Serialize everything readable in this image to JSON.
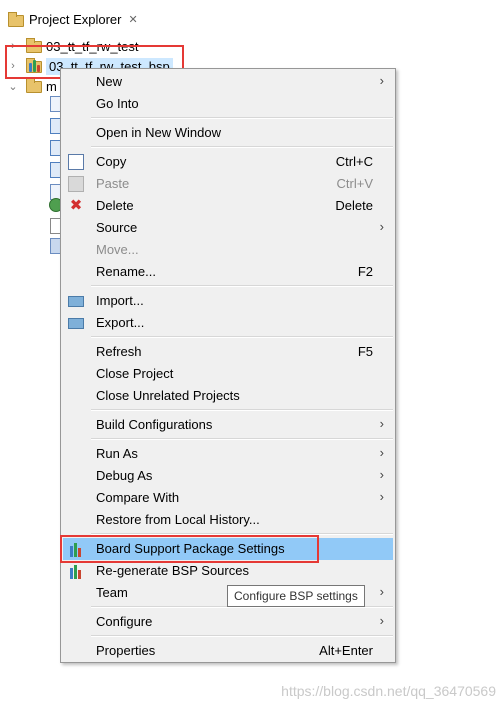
{
  "explorer": {
    "title": "Project Explorer",
    "close_glyph": "✕",
    "items": [
      {
        "label": "03_tt_tf_rw_test",
        "expanded": false
      },
      {
        "label": "03_tt_tf_rw_test_bsp",
        "expanded": false,
        "selected": true
      },
      {
        "label": "m",
        "expanded": true
      }
    ]
  },
  "menu": {
    "items": [
      {
        "label": "New",
        "mnemonic": "N",
        "shortcut": "",
        "submenu": true
      },
      {
        "label": "Go Into",
        "mnemonic": "I",
        "shortcut": ""
      },
      {
        "label": "Open in New Window",
        "mnemonic": "N",
        "shortcut": ""
      },
      {
        "label": "Copy",
        "mnemonic": "C",
        "shortcut": "Ctrl+C",
        "icon": "copy-icon"
      },
      {
        "label": "Paste",
        "mnemonic": "P",
        "shortcut": "Ctrl+V",
        "disabled": true,
        "icon": "paste-icon"
      },
      {
        "label": "Delete",
        "mnemonic": "D",
        "shortcut": "Delete",
        "icon": "delete-icon"
      },
      {
        "label": "Source",
        "mnemonic": "S",
        "shortcut": "",
        "submenu": true
      },
      {
        "label": "Move...",
        "mnemonic": "v",
        "shortcut": "",
        "disabled": true
      },
      {
        "label": "Rename...",
        "mnemonic": "m",
        "shortcut": "F2"
      },
      {
        "label": "Import...",
        "mnemonic": "I",
        "shortcut": "",
        "icon": "import-icon"
      },
      {
        "label": "Export...",
        "mnemonic": "o",
        "shortcut": "",
        "icon": "export-icon"
      },
      {
        "label": "Refresh",
        "mnemonic": "f",
        "shortcut": "F5"
      },
      {
        "label": "Close Project",
        "mnemonic": "",
        "shortcut": ""
      },
      {
        "label": "Close Unrelated Projects",
        "mnemonic": "U",
        "shortcut": ""
      },
      {
        "label": "Build Configurations",
        "mnemonic": "",
        "shortcut": "",
        "submenu": true
      },
      {
        "label": "Run As",
        "mnemonic": "R",
        "shortcut": "",
        "submenu": true
      },
      {
        "label": "Debug As",
        "mnemonic": "D",
        "shortcut": "",
        "submenu": true
      },
      {
        "label": "Compare With",
        "mnemonic": "p",
        "shortcut": "",
        "submenu": true
      },
      {
        "label": "Restore from Local History...",
        "mnemonic": "y",
        "shortcut": ""
      },
      {
        "label": "Board Support Package Settings",
        "mnemonic": "",
        "shortcut": "",
        "icon": "bsp-icon",
        "hovered": true
      },
      {
        "label": "Re-generate BSP Sources",
        "mnemonic": "",
        "shortcut": "",
        "icon": "bsp-icon"
      },
      {
        "label": "Team",
        "mnemonic": "e",
        "shortcut": "",
        "submenu": true
      },
      {
        "label": "Configure",
        "mnemonic": "g",
        "shortcut": "",
        "submenu": true
      },
      {
        "label": "Properties",
        "mnemonic": "r",
        "shortcut": "Alt+Enter"
      }
    ]
  },
  "tooltip": "Configure BSP settings",
  "watermark": "https://blog.csdn.net/qq_36470569",
  "colors": {
    "highlight_box": "#e53935",
    "hover": "#91c9f7",
    "selection": "#cde8ff",
    "menu_bg": "#f0f0f0"
  }
}
